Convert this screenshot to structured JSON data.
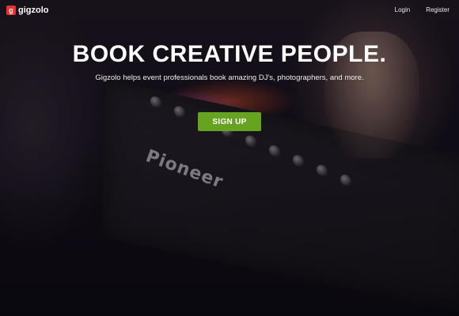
{
  "header": {
    "logo_text": "gigzolo",
    "logo_icon": "g-logo-icon",
    "nav": {
      "login": "Login",
      "register": "Register"
    }
  },
  "hero": {
    "headline": "BOOK CREATIVE PEOPLE.",
    "tagline": "Gigzolo helps event professionals book amazing DJ's, photographers, and more.",
    "cta_label": "SIGN UP"
  },
  "background": {
    "device_brand": "Pioneer"
  },
  "colors": {
    "cta": "#66a320",
    "logo": "#e8322e"
  }
}
